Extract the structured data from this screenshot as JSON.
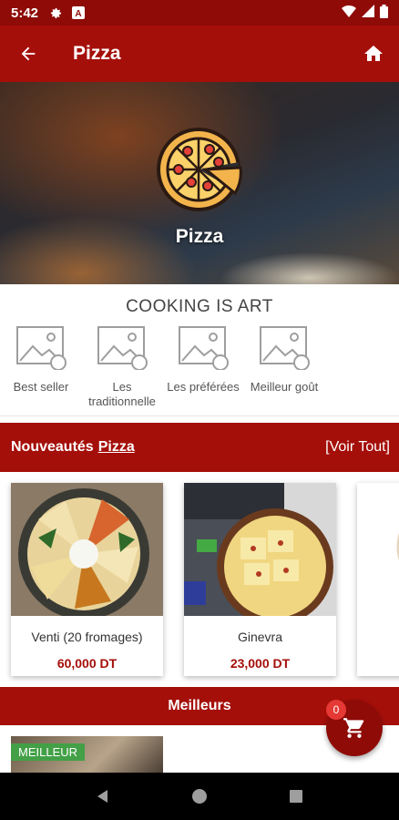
{
  "status_bar": {
    "time": "5:42",
    "icons": [
      "gear-icon",
      "a-badge-icon",
      "wifi-icon",
      "signal-icon",
      "battery-icon"
    ]
  },
  "app_bar": {
    "title": "Pizza",
    "back_icon": "arrow-back-icon",
    "home_icon": "home-icon"
  },
  "hero": {
    "label": "Pizza",
    "emblem_icon": "pizza-icon"
  },
  "cooking": {
    "title": "COOKING IS ART",
    "categories": [
      {
        "label": "Best seller",
        "icon": "image-placeholder-icon"
      },
      {
        "label": "Les traditionnelle",
        "icon": "image-placeholder-icon"
      },
      {
        "label": "Les préférées",
        "icon": "image-placeholder-icon"
      },
      {
        "label": "Meilleur goût",
        "icon": "image-placeholder-icon"
      }
    ]
  },
  "new_section": {
    "prefix": "Nouveautés",
    "link": "Pizza",
    "see_all": "[Voir Tout]"
  },
  "products": [
    {
      "name": "Venti (20 fromages)",
      "price": "60,000 DT"
    },
    {
      "name": "Ginevra",
      "price": "23,000 DT"
    }
  ],
  "best_section": {
    "title": "Meilleurs",
    "badge": "MEILLEUR"
  },
  "cart": {
    "count": "0",
    "icon": "cart-icon"
  },
  "nav": {
    "icons": [
      "back-triangle-icon",
      "home-circle-icon",
      "recents-square-icon"
    ]
  },
  "colors": {
    "primary": "#a50f0a",
    "primary_dark": "#8e0b07",
    "badge_green": "#43a047",
    "badge_red": "#e53935"
  }
}
